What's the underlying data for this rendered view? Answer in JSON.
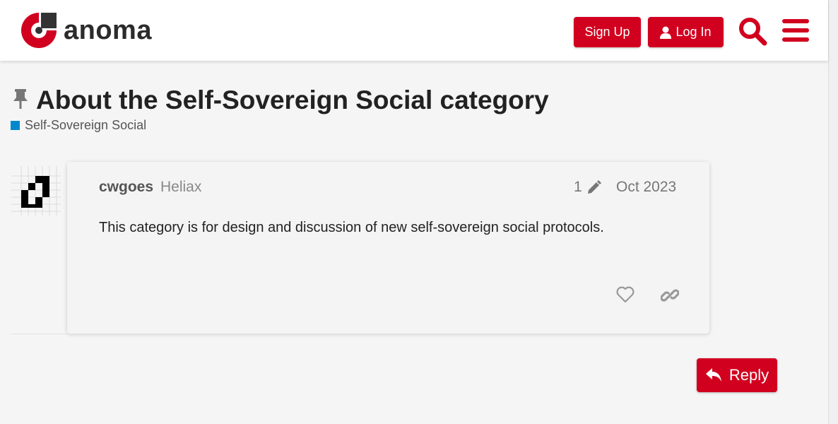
{
  "header": {
    "logo_text": "anoma",
    "signup_label": "Sign Up",
    "login_label": "Log In",
    "accent_color": "#d1001f"
  },
  "topic": {
    "title": "About the Self-Sovereign Social category",
    "category": "Self-Sovereign Social",
    "category_color": "#0088cc"
  },
  "post": {
    "username": "cwgoes",
    "user_title": "Heliax",
    "edit_count": "1",
    "date": "Oct 2023",
    "body": "This category is for design and discussion of new self-sovereign social protocols."
  },
  "reply_label": "Reply",
  "icons": [
    "pin-icon",
    "search-icon",
    "hamburger-menu-icon",
    "user-icon",
    "pencil-icon",
    "heart-icon",
    "link-icon",
    "reply-arrow-icon"
  ]
}
